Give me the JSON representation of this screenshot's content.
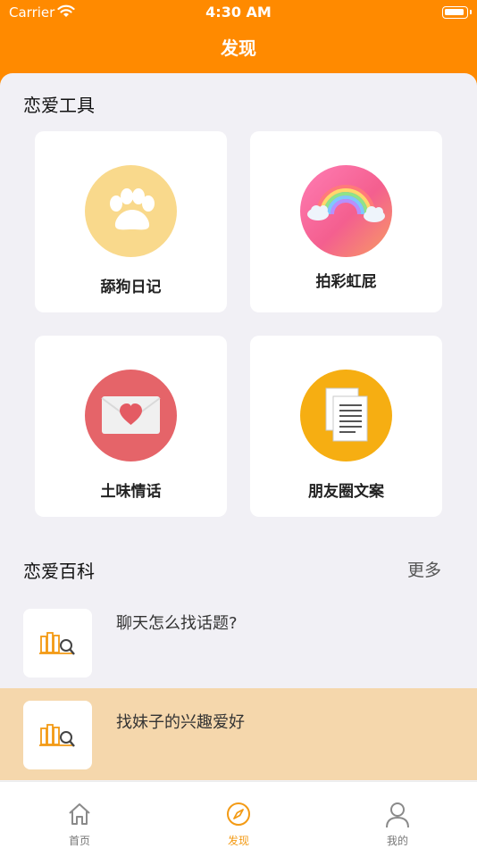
{
  "status_bar": {
    "carrier": "Carrier",
    "time": "4:30 AM"
  },
  "header": {
    "title": "发现"
  },
  "tools_section": {
    "title": "恋爱工具",
    "tools": [
      {
        "label": "舔狗日记",
        "icon": "paw-icon",
        "color": "#f9d98c"
      },
      {
        "label": "拍彩虹屁",
        "icon": "rainbow-icon",
        "color": "#f66aa0"
      },
      {
        "label": "土味情话",
        "icon": "heart-envelope-icon",
        "color": "#e56469"
      },
      {
        "label": "朋友圈文案",
        "icon": "document-icon",
        "color": "#f6ae12"
      }
    ]
  },
  "wiki_section": {
    "title": "恋爱百科",
    "more_label": "更多",
    "items": [
      {
        "title": "聊天怎么找话题?",
        "icon": "books-search-icon"
      },
      {
        "title": "找妹子的兴趣爱好",
        "icon": "books-search-icon",
        "highlighted": true
      }
    ]
  },
  "tab_bar": {
    "tabs": [
      {
        "label": "首页",
        "icon": "home-icon",
        "active": false
      },
      {
        "label": "发现",
        "icon": "compass-icon",
        "active": true
      },
      {
        "label": "我的",
        "icon": "person-icon",
        "active": false
      }
    ]
  },
  "colors": {
    "brand": "#ff8a00",
    "highlight_row": "#f5d7ac",
    "active_tab": "#f39a14"
  }
}
